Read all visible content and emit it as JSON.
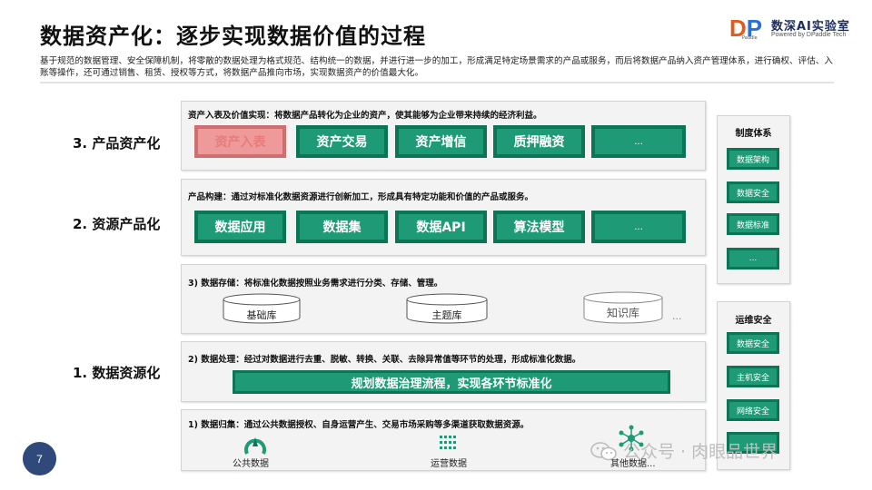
{
  "header": {
    "title": "数据资产化：逐步实现数据价值的过程",
    "intro": "基于规范的数据管理、安全保障机制，将零散的数据处理为格式规范、结构统一的数据，并进行进一步的加工，形成满足特定场景需求的产品或服务，而后将数据产品纳入资产管理体系，进行确权、评估、入账等操作，还可通过销售、租赁、授权等方式，将数据产品推向市场，实现数据资产的价值最大化。"
  },
  "logo": {
    "d": "D",
    "p": "P",
    "d_sub": "Paddle",
    "name": "数深AI实验室",
    "subtitle": "Powered by DPaddle Tech"
  },
  "levels": {
    "level3_label": "3. 产品资产化",
    "level2_label": "2. 资源产品化",
    "level1_label": "1. 数据资源化"
  },
  "panel_asset": {
    "title": "资产入表及价值实现：将数据产品转化为企业的资产，使其能够为企业带来持续的经济利益。",
    "items": [
      "资产入表",
      "资产交易",
      "资产增信",
      "质押融资",
      "..."
    ]
  },
  "panel_product": {
    "title": "产品构建：通过对标准化数据资源进行创新加工，形成具有特定功能和价值的产品或服务。",
    "items": [
      "数据应用",
      "数据集",
      "数据API",
      "算法模型",
      "..."
    ]
  },
  "panel_storage": {
    "title": "3) 数据存储：将标准化数据按照业务需求进行分类、存储、管理。",
    "dbs": [
      "基础库",
      "主题库",
      "知识库"
    ],
    "more": "..."
  },
  "panel_process": {
    "title": "2) 数据处理：经过对数据进行去重、脱敏、转换、关联、去除异常值等环节的处理，形成标准化数据。",
    "bar": "规划数据治理流程，实现各环节标准化"
  },
  "panel_collect": {
    "title": "1) 数据归集：通过公共数据授权、自身运营产生、交易市场采购等多渠道获取数据资源。",
    "sources": [
      "公共数据",
      "运营数据",
      "其他数据..."
    ]
  },
  "side_system": {
    "title": "制度体系",
    "items": [
      "数据架构",
      "数据安全",
      "数据标准",
      "..."
    ]
  },
  "side_security": {
    "title": "运维安全",
    "items": [
      "数据安全",
      "主机安全",
      "网络安全",
      "..."
    ]
  },
  "footer": {
    "page_number": "7",
    "watermark": "公众号 · 肉眼品世界"
  },
  "colors": {
    "accent_green": "#1e9b76",
    "border_green": "#0c7556",
    "highlight_red": "#ee9a9a",
    "page_badge": "#2f4a7a"
  }
}
